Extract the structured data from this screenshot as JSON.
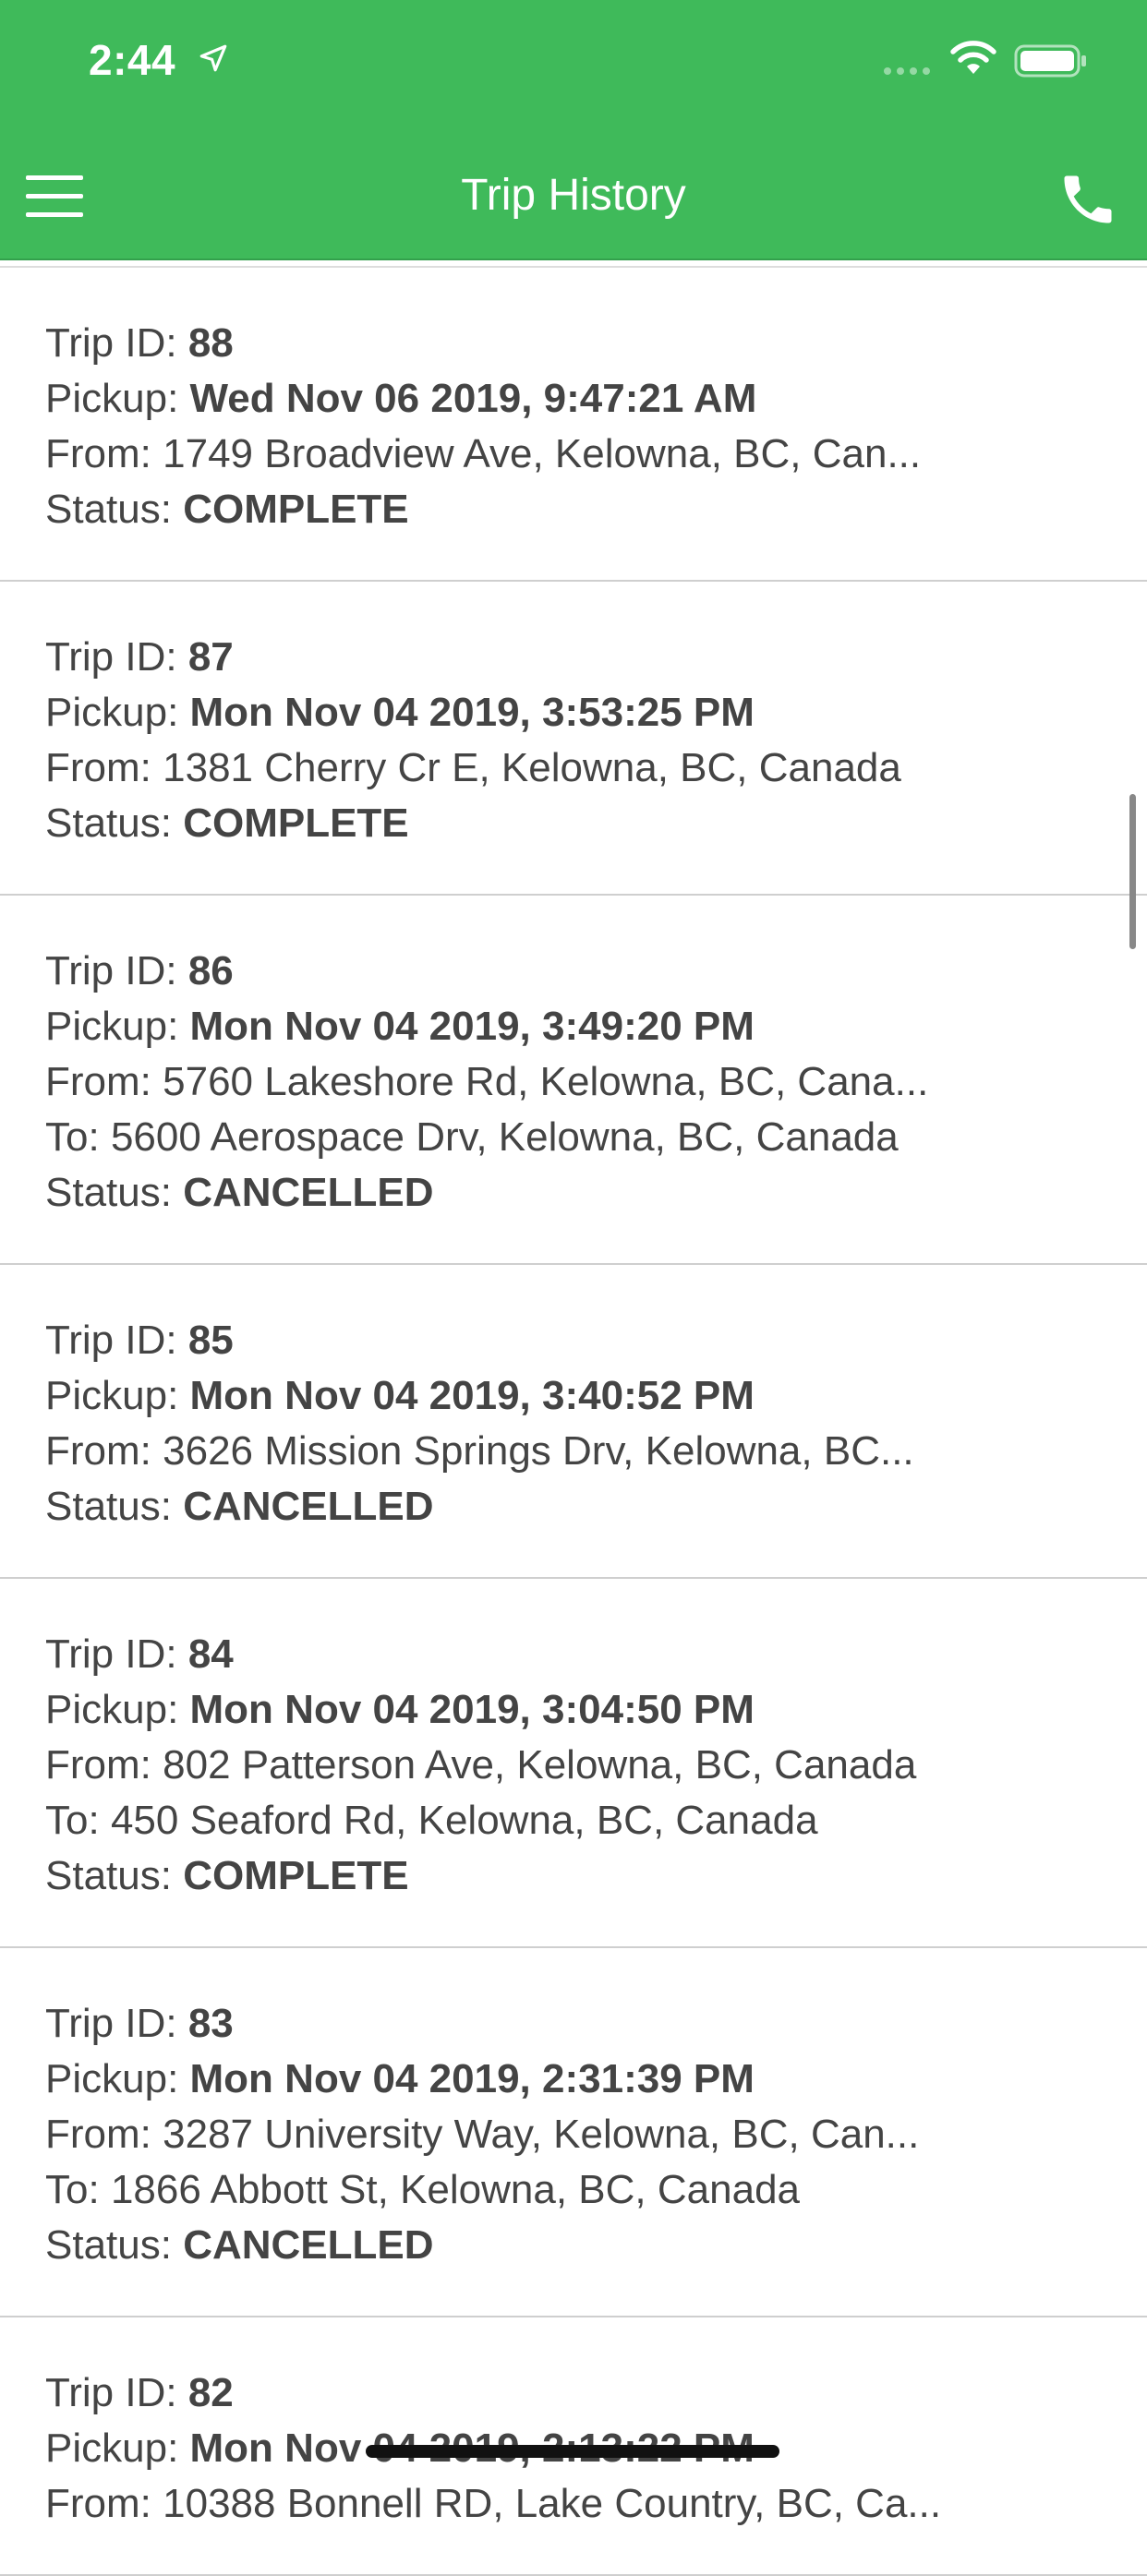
{
  "status_bar": {
    "time": "2:44"
  },
  "nav": {
    "title": "Trip History"
  },
  "labels": {
    "trip_id": "Trip ID:",
    "pickup": "Pickup:",
    "from": "From:",
    "to": "To:",
    "status": "Status:"
  },
  "trips": [
    {
      "id": "88",
      "pickup": "Wed Nov 06 2019, 9:47:21 AM",
      "from": "1749 Broadview Ave, Kelowna, BC, Can...",
      "to": null,
      "status": "COMPLETE"
    },
    {
      "id": "87",
      "pickup": "Mon Nov 04 2019, 3:53:25 PM",
      "from": "1381 Cherry Cr E, Kelowna, BC, Canada",
      "to": null,
      "status": "COMPLETE"
    },
    {
      "id": "86",
      "pickup": "Mon Nov 04 2019, 3:49:20 PM",
      "from": "5760 Lakeshore Rd, Kelowna, BC, Cana...",
      "to": "5600 Aerospace Drv, Kelowna, BC, Canada",
      "status": "CANCELLED"
    },
    {
      "id": "85",
      "pickup": "Mon Nov 04 2019, 3:40:52 PM",
      "from": "3626 Mission Springs Drv, Kelowna, BC...",
      "to": null,
      "status": "CANCELLED"
    },
    {
      "id": "84",
      "pickup": "Mon Nov 04 2019, 3:04:50 PM",
      "from": "802 Patterson Ave, Kelowna, BC, Canada",
      "to": "450 Seaford Rd, Kelowna, BC, Canada",
      "status": "COMPLETE"
    },
    {
      "id": "83",
      "pickup": "Mon Nov 04 2019, 2:31:39 PM",
      "from": "3287 University Way, Kelowna, BC, Can...",
      "to": "1866 Abbott St, Kelowna, BC, Canada",
      "status": "CANCELLED"
    },
    {
      "id": "82",
      "pickup": "Mon Nov 04 2019, 2:13:22 PM",
      "from": "10388 Bonnell RD, Lake Country, BC, Ca...",
      "to": null,
      "status": ""
    }
  ],
  "icons": {
    "menu": "hamburger-menu-icon",
    "phone": "phone-icon",
    "location": "location-arrow-icon",
    "wifi": "wifi-icon",
    "battery": "battery-icon",
    "signal": "cellular-signal-icon"
  },
  "colors": {
    "header_green": "#3fba5a",
    "text": "#444444",
    "divider": "#cfcfcf"
  }
}
